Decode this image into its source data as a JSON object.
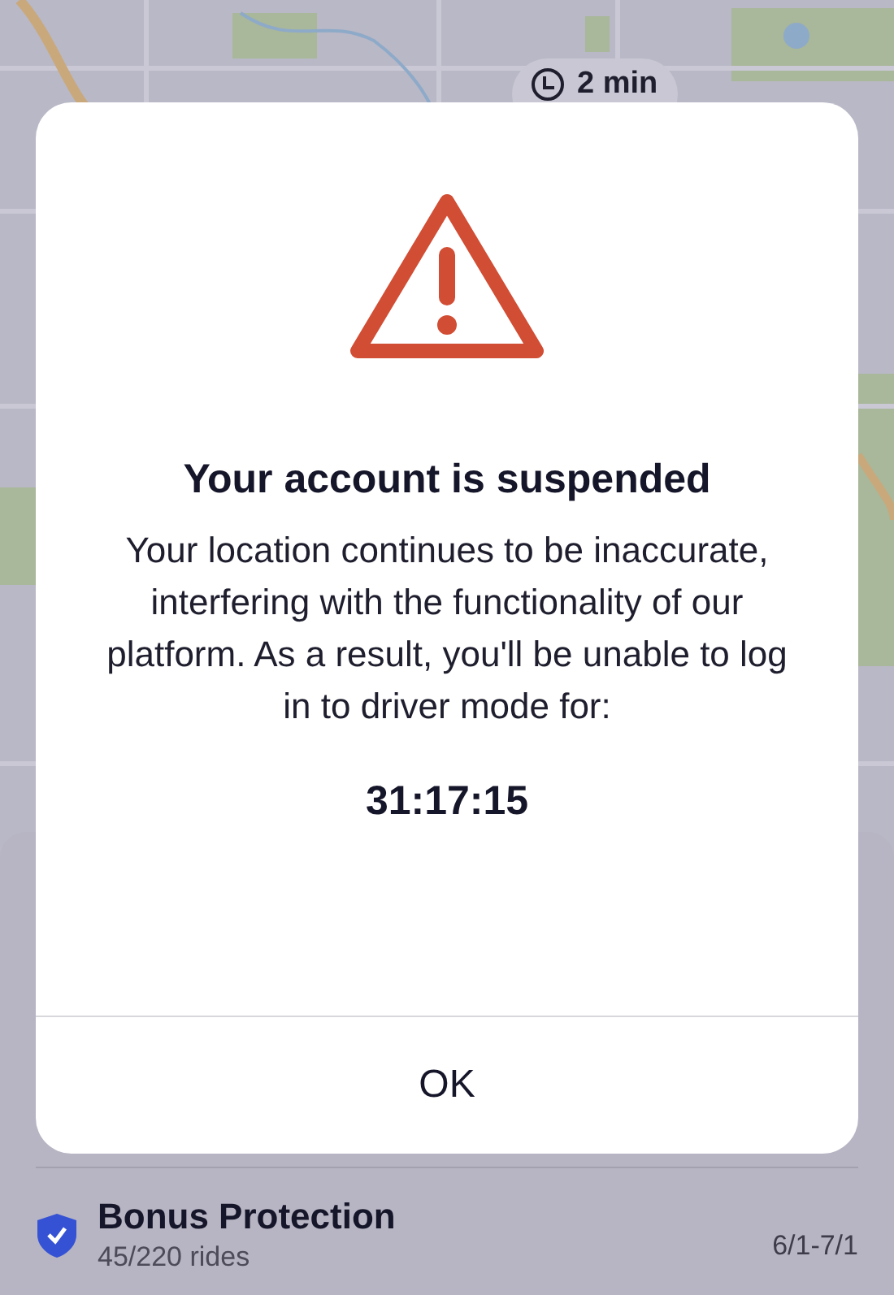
{
  "map_chip": {
    "label": "2 min"
  },
  "dialog": {
    "title": "Your account is suspended",
    "message": "Your location continues to be inaccurate, interfering with the functionality of our platform. As a result, you'll be unable to log in to driver mode for:",
    "countdown": "31:17:15",
    "button": "OK"
  },
  "bonus": {
    "title": "Bonus Protection",
    "subtitle": "45/220 rides",
    "dates": "6/1-7/1"
  }
}
